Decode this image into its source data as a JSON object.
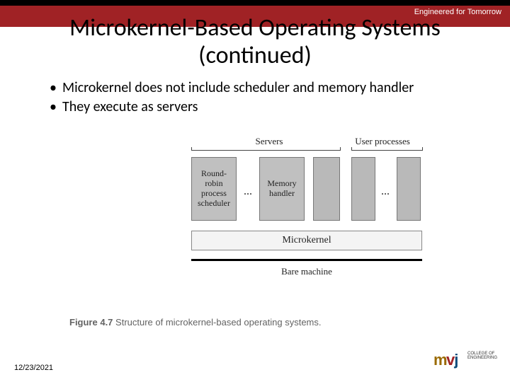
{
  "header": {
    "tagline": "Engineered for Tomorrow"
  },
  "title": {
    "line1": "Microkernel-Based Operating Systems",
    "line2": "(continued)"
  },
  "bullets": {
    "items": [
      "Microkernel does not include scheduler and memory handler",
      "They execute as servers"
    ]
  },
  "diagram": {
    "labels": {
      "servers": "Servers",
      "user_processes": "User processes",
      "scheduler": "Round-\nrobin\nprocess\nscheduler",
      "memory": "Memory\nhandler",
      "ellipsis": "...",
      "microkernel": "Microkernel",
      "bare_machine": "Bare machine"
    }
  },
  "figure_caption": {
    "fig": "Figure 4.7",
    "text": "Structure of microkernel-based operating systems."
  },
  "footer": {
    "date": "12/23/2021"
  },
  "logo": {
    "m": "m",
    "v": "v",
    "j": "j",
    "line1": "COLLEGE OF",
    "line2": "ENGINEERING"
  }
}
